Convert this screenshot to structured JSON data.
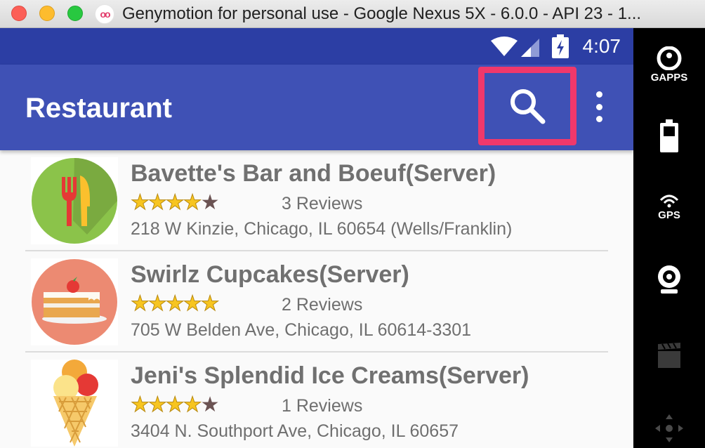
{
  "window": {
    "title": "Genymotion for personal use - Google Nexus 5X - 6.0.0 - API 23 - 1...",
    "logo_text": "oo"
  },
  "status_bar": {
    "time": "4:07"
  },
  "app_bar": {
    "title": "Restaurant",
    "search_icon": "search-icon",
    "overflow_icon": "more-vert-icon",
    "highlight_color": "#f0386b",
    "bar_color": "#3f51b5"
  },
  "restaurants": [
    {
      "name": "Bavette's Bar and Boeuf(Server)",
      "rating": 4,
      "reviews": "3 Reviews",
      "address": "218 W Kinzie, Chicago, IL 60654 (Wells/Franklin)",
      "icon": "fork-knife-icon"
    },
    {
      "name": "Swirlz Cupcakes(Server)",
      "rating": 5,
      "reviews": "2 Reviews",
      "address": "705 W Belden Ave, Chicago, IL 60614-3301",
      "icon": "cake-icon"
    },
    {
      "name": "Jeni's Splendid Ice Creams(Server)",
      "rating": 4,
      "reviews": "1 Reviews",
      "address": "3404 N. Southport Ave, Chicago, IL 60657",
      "icon": "ice-cream-icon"
    }
  ],
  "toolbar": {
    "gapps_label": "GAPPS",
    "gps_label": "GPS"
  }
}
